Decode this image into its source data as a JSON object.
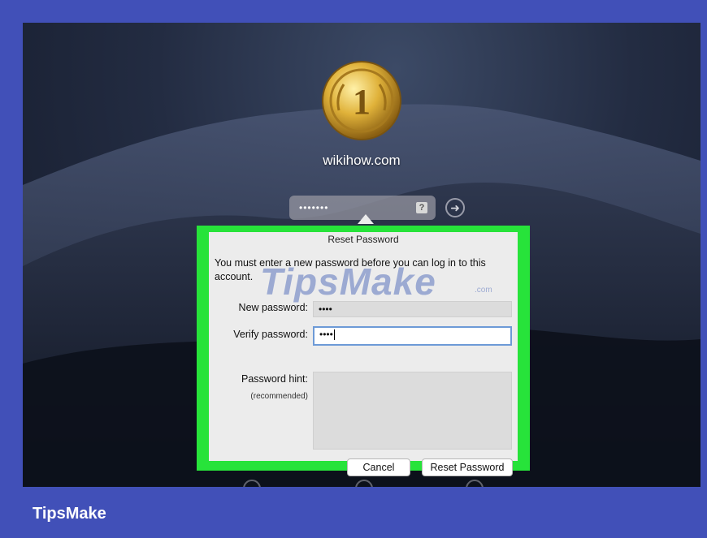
{
  "lock_screen": {
    "username": "wikihow.com",
    "password_mask": "•••••••",
    "hint_icon": "question-icon",
    "submit_icon": "arrow-right-icon",
    "avatar_numeral": "1"
  },
  "dialog": {
    "title": "Reset Password",
    "message": "You must enter a new password before you can log in to this account.",
    "new_password_label": "New password:",
    "new_password_value": "••••",
    "verify_password_label": "Verify password:",
    "verify_password_value": "••••",
    "hint_label": "Password hint:",
    "hint_sublabel": "(recommended)",
    "hint_value": "",
    "cancel_label": "Cancel",
    "reset_label": "Reset Password"
  },
  "watermark": {
    "text": "TipsMake",
    "suffix": ".com"
  },
  "footer": {
    "brand": "TipsMake"
  },
  "colors": {
    "frame_border": "#4150b8",
    "highlight": "#27e33a",
    "focus_ring": "#6d9ad7"
  }
}
